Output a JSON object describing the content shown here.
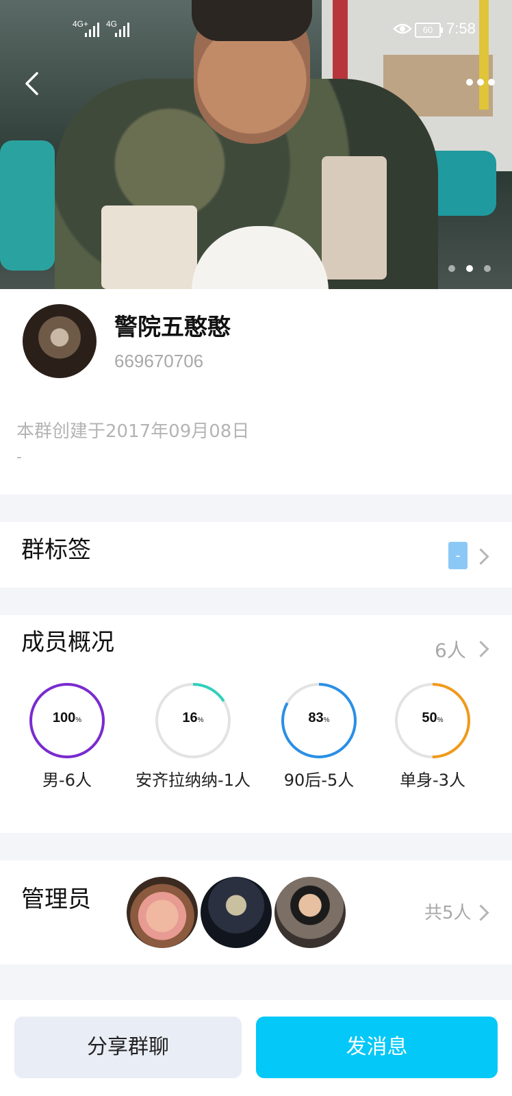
{
  "status_bar": {
    "network1": "4G+",
    "network2": "4G",
    "battery": "60",
    "time": "7:58"
  },
  "header": {
    "back_icon": "chevron-left-icon",
    "more_icon": "more-dots-icon",
    "carousel_pages": 3,
    "carousel_active": 1
  },
  "group": {
    "name": "警院五憨憨",
    "id": "669670706",
    "created": "本群创建于2017年09月08日",
    "intro": "-"
  },
  "tags": {
    "title": "群标签",
    "chip": "-"
  },
  "members": {
    "title": "成员概况",
    "count": "6人",
    "stats": [
      {
        "percent": "100",
        "unit": "%",
        "label": "男-6人",
        "value": 1.0,
        "color": "#7a2bd0"
      },
      {
        "percent": "16",
        "unit": "%",
        "label": "安齐拉纳纳-1人",
        "value": 0.16,
        "color": "#2ed0bb"
      },
      {
        "percent": "83",
        "unit": "%",
        "label": "90后-5人",
        "value": 0.83,
        "color": "#2a8fe6"
      },
      {
        "percent": "50",
        "unit": "%",
        "label": "单身-3人",
        "value": 0.5,
        "color": "#f09a1a"
      }
    ]
  },
  "admins": {
    "title": "管理员",
    "count": "共5人"
  },
  "actions": {
    "share": "分享群聊",
    "message": "发消息"
  }
}
